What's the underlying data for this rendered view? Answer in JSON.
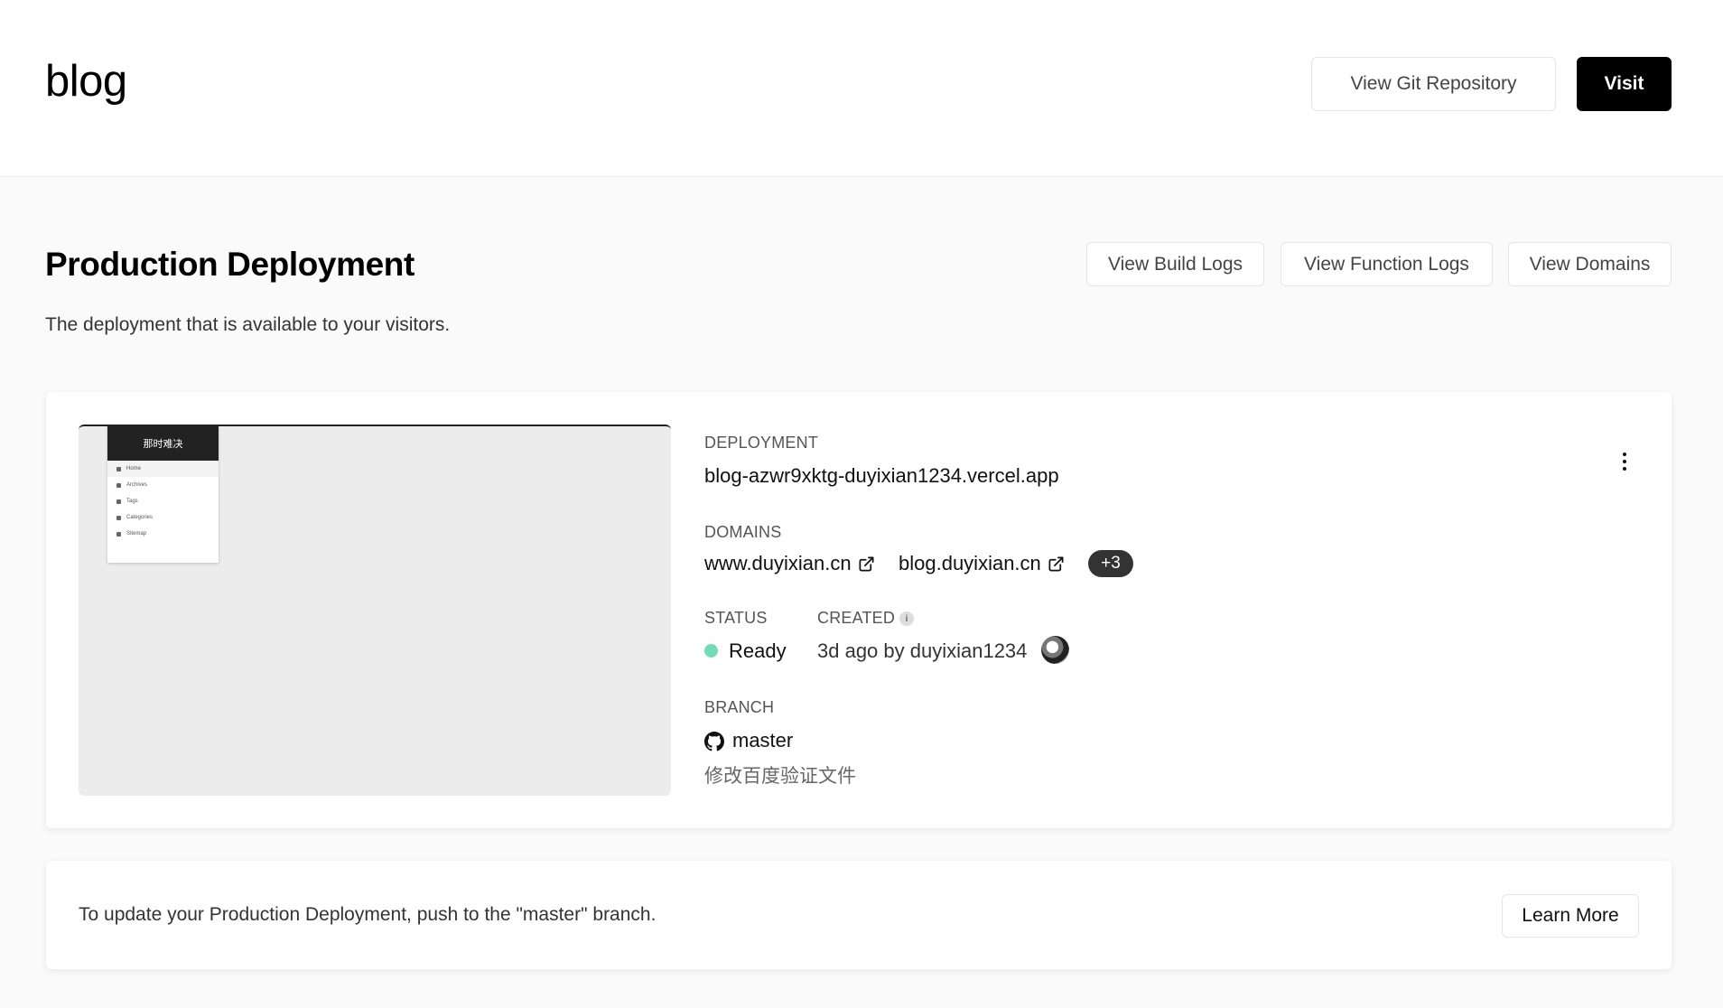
{
  "header": {
    "project_title": "blog",
    "git_button": "View Git Repository",
    "visit_button": "Visit"
  },
  "production": {
    "title": "Production Deployment",
    "subtitle": "The deployment that is available to your visitors.",
    "build_logs_button": "View Build Logs",
    "function_logs_button": "View Function Logs",
    "domains_button": "View Domains"
  },
  "preview": {
    "site_title": "那时难决",
    "menu": [
      "Home",
      "Archives",
      "Tags",
      "Categories",
      "Sitemap"
    ]
  },
  "deployment": {
    "label": "DEPLOYMENT",
    "url": "blog-azwr9xktg-duyixian1234.vercel.app",
    "domains_label": "DOMAINS",
    "domains": [
      "www.duyixian.cn",
      "blog.duyixian.cn"
    ],
    "more_domains": "+3",
    "status_label": "STATUS",
    "status": "Ready",
    "status_color": "#73dbb6",
    "created_label": "CREATED",
    "created": "3d ago by duyixian1234",
    "branch_label": "BRANCH",
    "branch": "master",
    "commit_message": "修改百度验证文件"
  },
  "footer_card": {
    "text": "To update your Production Deployment, push to the \"master\" branch.",
    "learn_more_button": "Learn More"
  }
}
